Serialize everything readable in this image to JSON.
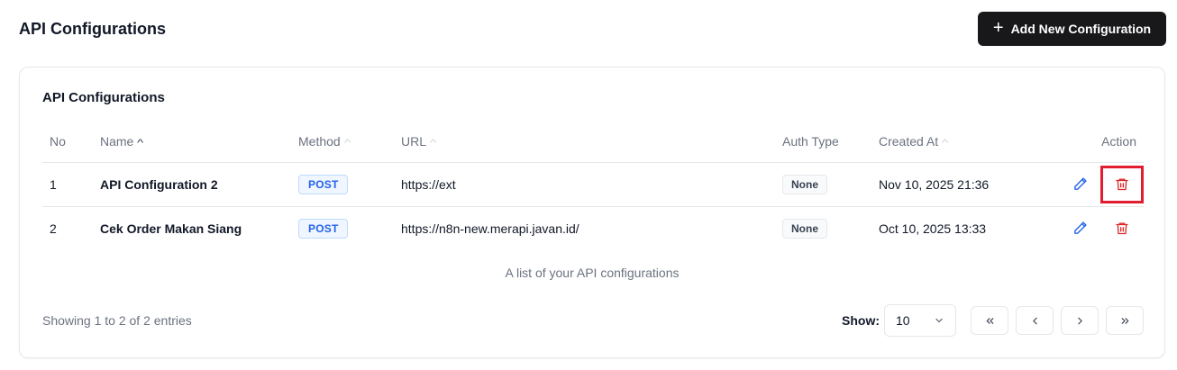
{
  "header": {
    "title": "API Configurations",
    "add_button_label": "Add New Configuration"
  },
  "card": {
    "title": "API Configurations"
  },
  "table": {
    "columns": {
      "no": "No",
      "name": "Name",
      "method": "Method",
      "url": "URL",
      "auth": "Auth Type",
      "created": "Created At",
      "action": "Action"
    },
    "rows": [
      {
        "no": "1",
        "name": "API Configuration 2",
        "method": "POST",
        "url": "https://ext",
        "auth": "None",
        "created": "Nov 10, 2025 21:36"
      },
      {
        "no": "2",
        "name": "Cek Order Makan Siang",
        "method": "POST",
        "url": "https://n8n-new.merapi.javan.id/",
        "auth": "None",
        "created": "Oct 10, 2025 13:33"
      }
    ],
    "caption": "A list of your API configurations"
  },
  "footer": {
    "info": "Showing 1 to 2 of 2 entries",
    "show_label": "Show:",
    "page_size": "10"
  },
  "colors": {
    "accent": "#18181b",
    "method_badge": "#2563eb",
    "edit_icon": "#2563eb",
    "delete_icon": "#dc2626",
    "highlight": "#e11d2f"
  }
}
